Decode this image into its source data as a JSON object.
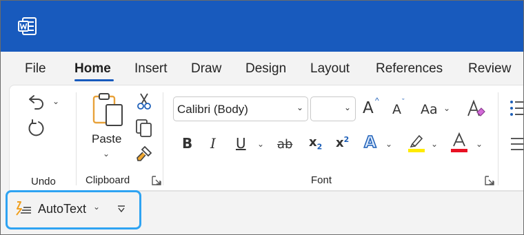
{
  "app": {
    "name": "Word",
    "logo_icon": "word-logo-icon",
    "accent": "#185abd"
  },
  "tabs": [
    {
      "label": "File"
    },
    {
      "label": "Home",
      "active": true
    },
    {
      "label": "Insert"
    },
    {
      "label": "Draw"
    },
    {
      "label": "Design"
    },
    {
      "label": "Layout"
    },
    {
      "label": "References"
    },
    {
      "label": "Review"
    }
  ],
  "ribbon": {
    "undo": {
      "label": "Undo"
    },
    "clipboard": {
      "label": "Clipboard",
      "paste_label": "Paste"
    },
    "font": {
      "label": "Font",
      "font_name": "Calibri (Body)",
      "font_size": "",
      "bold": "B",
      "italic": "I",
      "underline": "U",
      "strikethrough": "ab",
      "subscript_base": "x",
      "subscript_mark": "2",
      "superscript_base": "x",
      "superscript_mark": "2",
      "text_effects": "A",
      "highlight_color": "#ffeb00",
      "font_color": "#e81123",
      "font_color_letter": "A",
      "grow_font": "A",
      "shrink_font": "A",
      "change_case": "Aa"
    }
  },
  "quick_access": {
    "autotext_label": "AutoText",
    "highlight_color": "#2ea3f2"
  }
}
